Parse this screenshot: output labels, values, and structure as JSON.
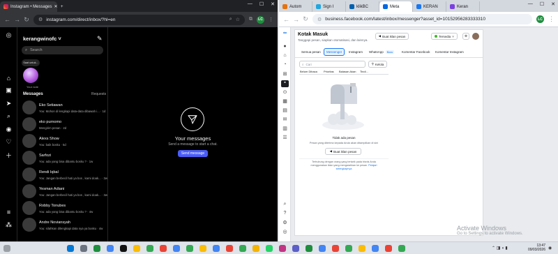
{
  "left_window": {
    "tab_title": "Instagram • Messages",
    "url": "instagram.com/direct/inbox/?hl=en",
    "profile_initials": "LC",
    "colors": {
      "accent": "#4a5df9"
    }
  },
  "instagram": {
    "username": "kerangwinofc",
    "search_placeholder": "Search",
    "note_bubble": "Saat untuk...",
    "note_label": "Your note",
    "messages_heading": "Messages",
    "requests_label": "Requests",
    "conversations": [
      {
        "name": "Eko Setiawan",
        "preview": "You: Mohon di lengkapi data-data dibawah i... · 1d"
      },
      {
        "name": "eko purnomo",
        "preview": "Mengirim pesan · 2d"
      },
      {
        "name": "Alexs Show",
        "preview": "You: baik bosku · 5d"
      },
      {
        "name": "Sarfozi",
        "preview": "You: ada yang bisa dibantu bosku ? · 1w"
      },
      {
        "name": "Rendi Iqbal",
        "preview": "You: Jangan berbecil hati ya bos , kami doak... · 3w"
      },
      {
        "name": "Yesman Adiani",
        "preview": "You: Jangan berbecil hati ya bos , kami doak... · 3w"
      },
      {
        "name": "Robby Tonubes",
        "preview": "You: ada yang bisa dibantu bosku ? · 4w"
      },
      {
        "name": "Andre Noviansyah",
        "preview": "You: silahkan dilengkapi data nya ya bosku · 4w"
      }
    ],
    "empty_title": "Your messages",
    "empty_subtitle": "Send a message to start a chat.",
    "send_button": "Send message"
  },
  "right_window": {
    "tabs": [
      "Autom",
      "Sign I",
      "klikBC",
      "Meta",
      "KERAN",
      "Keran"
    ],
    "active_tab_index": 3,
    "url": "business.facebook.com/latest/inbox/messenger?asset_id=10152956283333310",
    "profile_initials": "LC"
  },
  "facebook": {
    "page_title": "Kotak Masuk",
    "page_subtitle": "Tanggapi pesan, siapkan otomatisasi, dan lainnya.",
    "create_post_button": "Buat iklan pesan",
    "status_label": "Tersedia",
    "tabs": [
      "Semua pesan",
      "Messenger",
      "Instagram",
      "WhatsApp",
      "Komentar Facebook",
      "Komentar Instagram"
    ],
    "whatsapp_badge": "Baru",
    "search_placeholder": "Cari",
    "manage_button": "Kelola",
    "filters": [
      "Belum Dibaca",
      "Prioritas",
      "Balasan Akan",
      "Tindi..."
    ],
    "empty_title": "Tidak ada pesan",
    "empty_subtitle": "Pesan yang diterima kepada Anda akan ditampilkan di sini",
    "empty_button": "Buat iklan pesan",
    "footer_text": "Terhubung dengan orang yang tertarik pada bisnis Anda menggunakan iklan yang mengarahkan ke pesan.",
    "footer_link": "Pelajari selengkapnya"
  },
  "watermark": {
    "title": "Activate Windows",
    "subtitle": "Go to Settings to activate Windows."
  },
  "taskbar": {
    "time": "13:47",
    "date": "09/03/2026"
  }
}
